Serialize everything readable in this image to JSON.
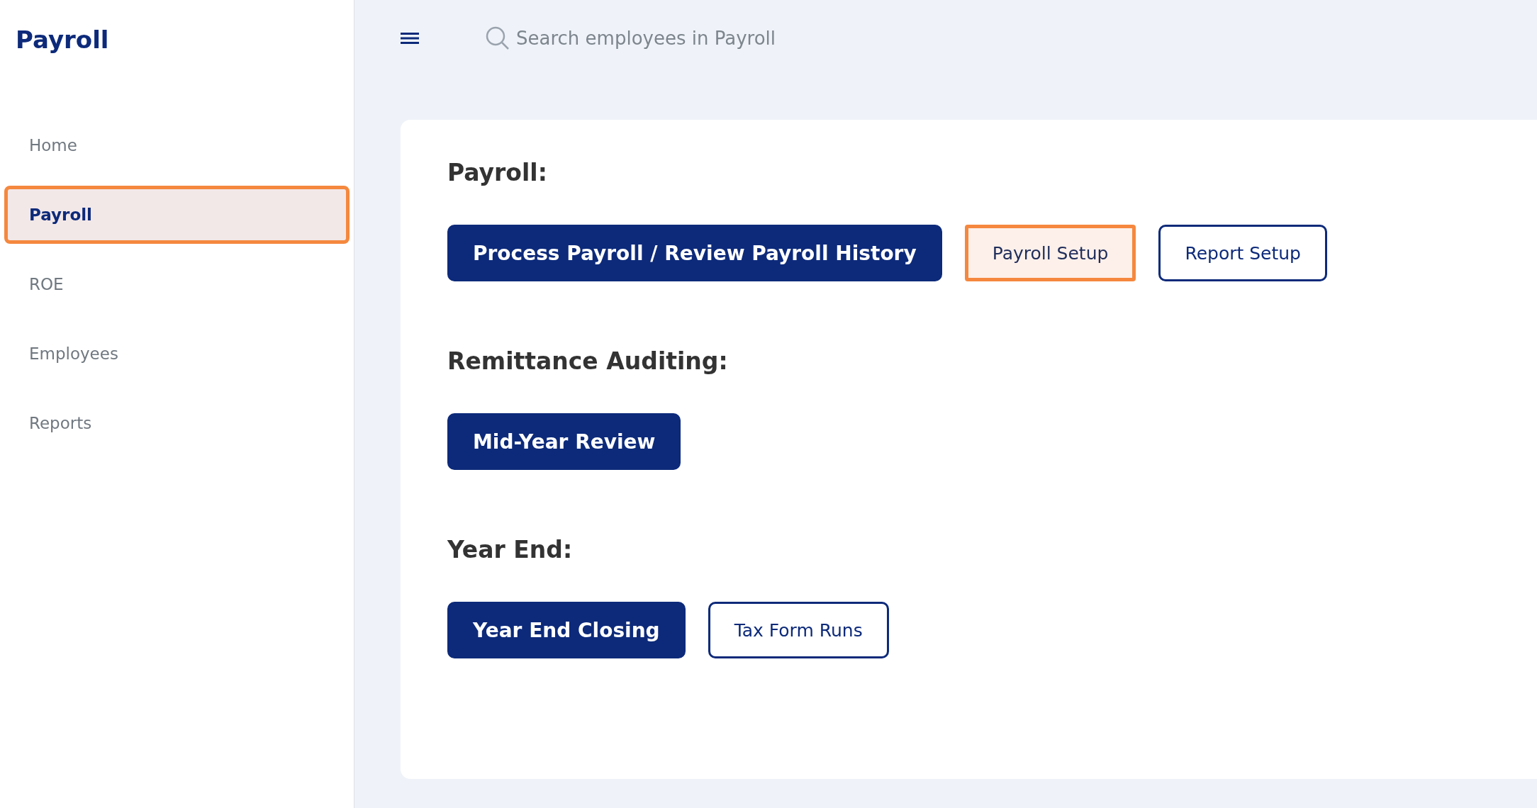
{
  "app_title": "Payroll",
  "sidebar": {
    "items": [
      {
        "label": "Home",
        "selected": false,
        "highlighted": false
      },
      {
        "label": "Payroll",
        "selected": true,
        "highlighted": true
      },
      {
        "label": "ROE",
        "selected": false,
        "highlighted": false
      },
      {
        "label": "Employees",
        "selected": false,
        "highlighted": false
      },
      {
        "label": "Reports",
        "selected": false,
        "highlighted": false
      }
    ]
  },
  "search": {
    "placeholder": "Search employees in Payroll"
  },
  "sections": [
    {
      "heading": "Payroll:",
      "buttons": [
        {
          "label": "Process Payroll / Review Payroll History",
          "kind": "primary",
          "highlighted": false
        },
        {
          "label": "Payroll Setup",
          "kind": "outline",
          "highlighted": true
        },
        {
          "label": "Report Setup",
          "kind": "outline",
          "highlighted": false
        }
      ]
    },
    {
      "heading": "Remittance Auditing:",
      "buttons": [
        {
          "label": "Mid-Year Review",
          "kind": "primary",
          "highlighted": false
        }
      ]
    },
    {
      "heading": "Year End:",
      "buttons": [
        {
          "label": "Year End Closing",
          "kind": "primary",
          "highlighted": false
        },
        {
          "label": "Tax Form Runs",
          "kind": "outline",
          "highlighted": false
        }
      ]
    }
  ]
}
